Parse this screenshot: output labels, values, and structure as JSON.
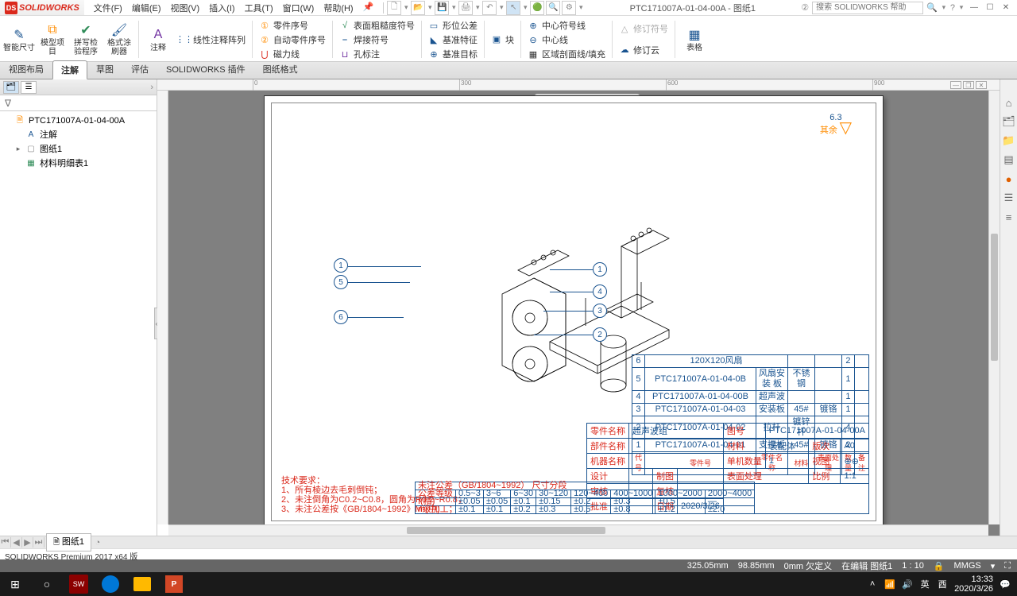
{
  "app": {
    "logo_text": "SOLIDWORKS",
    "doc_title": "PTC171007A-01-04-00A - 图纸1",
    "search_placeholder": "搜索 SOLIDWORKS 帮助",
    "premium_line": "SOLIDWORKS Premium 2017 x64 版"
  },
  "menubar": {
    "file": "文件(F)",
    "edit": "编辑(E)",
    "view": "视图(V)",
    "insert": "插入(I)",
    "tools": "工具(T)",
    "window": "窗口(W)",
    "help": "帮助(H)"
  },
  "ribbon": {
    "big": {
      "smart_dim": "智能尺寸",
      "model_items": "模型项\n目",
      "spell": "拼写检\n验程序",
      "format": "格式涂\n刷器",
      "note": "注释",
      "table": "表格"
    },
    "small": {
      "lpattern": "线性注释阵列",
      "balloon": "零件序号",
      "auto_balloon": "自动零件序号",
      "magnet": "磁力线",
      "surf_finish": "表面粗糙度符号",
      "weld_symbol": "焊接符号",
      "hole_callout": "孔标注",
      "gtol": "形位公差",
      "datum": "基准特征",
      "datum_target": "基准目标",
      "center_mark": "中心符号线",
      "centerline": "中心线",
      "area_hatch": "区域剖面线/填充",
      "rev_symbol": "修订符号",
      "rev_cloud": "修订云",
      "blocks": "块"
    }
  },
  "tabs": {
    "layout": "视图布局",
    "annotate": "注解",
    "sketch": "草图",
    "evaluate": "评估",
    "addins": "SOLIDWORKS 插件",
    "sheetfmt": "图纸格式"
  },
  "tree": {
    "root": "PTC171007A-01-04-00A",
    "annotations": "注解",
    "sheet1": "图纸1",
    "bom": "材料明细表1"
  },
  "sheet_tab": {
    "name": "图纸1"
  },
  "triad": {
    "label": "其余",
    "ra": "6.3"
  },
  "ruler": {
    "t0": "0",
    "t300": "300",
    "t600": "600",
    "t900": "900"
  },
  "balloons": {
    "b1": "1",
    "b2": "2",
    "b3": "3",
    "b4": "4",
    "b5": "5",
    "b6": "6"
  },
  "bom": {
    "rows": [
      {
        "no": "6",
        "pn": "",
        "name": "120X120风扇",
        "mat": "",
        "fin": "",
        "qty": "2"
      },
      {
        "no": "5",
        "pn": "PTC171007A-01-04-0B",
        "name": "风扇安装\n板",
        "mat": "不锈钢",
        "fin": "",
        "qty": "1"
      },
      {
        "no": "4",
        "pn": "PTC171007A-01-04-00B",
        "name": "超声波",
        "mat": "",
        "fin": "",
        "qty": "1"
      },
      {
        "no": "3",
        "pn": "PTC171007A-01-04-03",
        "name": "安装板",
        "mat": "45#",
        "fin": "镀铬",
        "qty": "1"
      },
      {
        "no": "2",
        "pn": "PTC171007A-01-04-02",
        "name": "拉杆",
        "mat": "镀锌杆",
        "fin": "",
        "qty": "4"
      },
      {
        "no": "1",
        "pn": "PTC171007A-01-04-01",
        "name": "支撑板",
        "mat": "45#",
        "fin": "镀铬",
        "qty": "2"
      }
    ],
    "hdr": {
      "no": "代号",
      "pn": "零件号",
      "name": "零件名称",
      "mat": "材料",
      "fin": "表面处理",
      "qty": "数量",
      "note": "备注"
    }
  },
  "titleblock": {
    "part_name_lbl": "零件名称",
    "part_name": "超声波组",
    "dept_name_lbl": "部件名称",
    "machine_name_lbl": "机器名称",
    "design_lbl": "设计",
    "check_lbl": "审核",
    "approve_lbl": "批准",
    "drawn_lbl": "制图",
    "recheck_lbl": "复核",
    "date_lbl": "日期",
    "date": "2020/3/26",
    "dwgno_lbl": "图号",
    "dwgno": "PTC171007A-01-04-00A",
    "mat_lbl": "材料",
    "assy_lbl": "装配体",
    "rev_lbl": "版次",
    "rev": "A0",
    "qty_lbl": "单机数量",
    "qty": "1",
    "view_lbl": "视图",
    "view": "⊕⊖",
    "fin_lbl": "表面处理",
    "scale_lbl": "比例",
    "scale": "1:1"
  },
  "technote": {
    "title": "技术要求：",
    "l1": "1、所有棱边去毛刺倒钝；",
    "l2": "2、未注倒角为C0.2~C0.8，圆角为R0.2~R0.8；",
    "l3": "3、未注公差按《GB/1804~1992》M级加工；"
  },
  "toltable": {
    "title": "未注公差（GB/1804~1992）  尺寸分段",
    "r1": [
      "0.5~3",
      "3~6",
      "6~30",
      "30~120",
      "120~400",
      "400~1000",
      "1000~2000",
      "2000~4000"
    ],
    "r2_lbl": "f(精)",
    "r2": [
      "±0.05",
      "±0.05",
      "±0.1",
      "±0.15",
      "±0.2",
      "±0.3",
      "±0.5",
      "—"
    ],
    "r3_lbl": "m(中)",
    "r3": [
      "±0.1",
      "±0.1",
      "±0.2",
      "±0.3",
      "±0.5",
      "±0.8",
      "±1.2",
      "±2.0"
    ]
  },
  "status": {
    "x": "325.05mm",
    "y": "98.85mm",
    "z": "0mm",
    "underdef": "欠定义",
    "editing": "在编辑 图纸1",
    "scale": "1 : 10",
    "units": "MMGS"
  },
  "taskbar": {
    "ime": "英",
    "time": "13:33",
    "date": "2020/3/26"
  }
}
